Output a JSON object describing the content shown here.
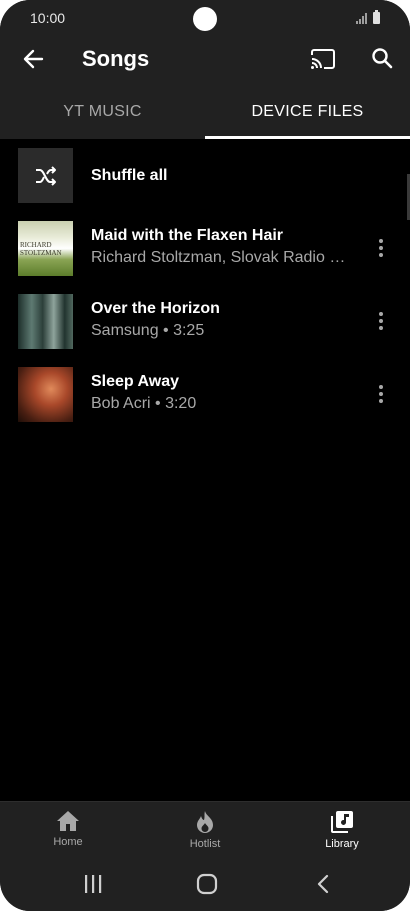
{
  "status_bar": {
    "time": "10:00"
  },
  "app_bar": {
    "title": "Songs",
    "back_icon": "arrow-left-icon",
    "cast_icon": "cast-icon",
    "search_icon": "search-icon"
  },
  "tabs": [
    {
      "label": "YT MUSIC",
      "selected": false
    },
    {
      "label": "DEVICE FILES",
      "selected": true
    }
  ],
  "shuffle": {
    "label": "Shuffle all",
    "icon": "shuffle-icon"
  },
  "songs": [
    {
      "title": "Maid with the Flaxen Hair",
      "subtitle": "Richard Stoltzman, Slovak Radio Sy…",
      "art_text": [
        "RICHARD",
        "STOLTZMAN"
      ]
    },
    {
      "title": "Over the Horizon",
      "subtitle": "Samsung • 3:25"
    },
    {
      "title": "Sleep Away",
      "subtitle": "Bob Acri • 3:20"
    }
  ],
  "bottom_nav": [
    {
      "label": "Home",
      "icon": "home-icon",
      "selected": false
    },
    {
      "label": "Hotlist",
      "icon": "flame-icon",
      "selected": false
    },
    {
      "label": "Library",
      "icon": "library-music-icon",
      "selected": true
    }
  ],
  "colors": {
    "surface": "#212121",
    "background": "#000000",
    "text_primary": "#ffffff",
    "text_secondary": "#a8a8a8"
  }
}
